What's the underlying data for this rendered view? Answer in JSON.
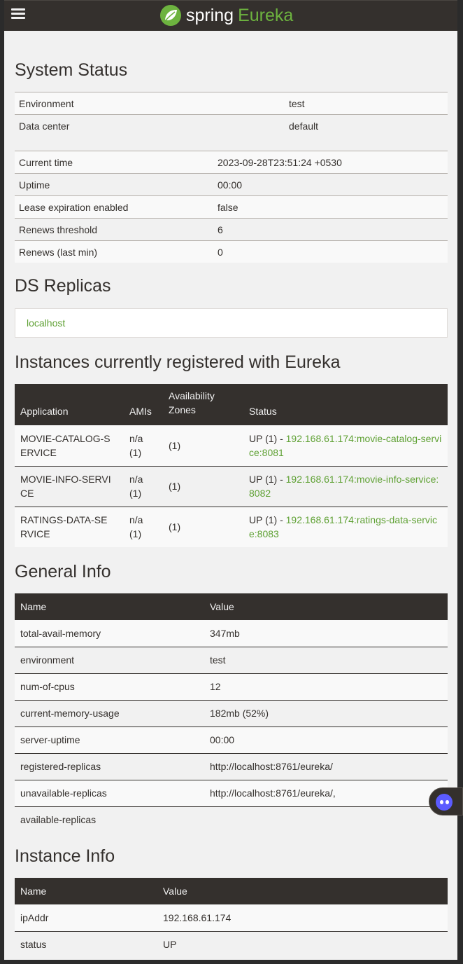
{
  "brand": {
    "spring": "spring",
    "eureka": "Eureka"
  },
  "system_status": {
    "title": "System Status",
    "env_rows": [
      {
        "label": "Environment",
        "value": "test"
      },
      {
        "label": "Data center",
        "value": "default"
      }
    ],
    "time_rows": [
      {
        "label": "Current time",
        "value": "2023-09-28T23:51:24 +0530"
      },
      {
        "label": "Uptime",
        "value": "00:00"
      },
      {
        "label": "Lease expiration enabled",
        "value": "false"
      },
      {
        "label": "Renews threshold",
        "value": "6"
      },
      {
        "label": "Renews (last min)",
        "value": "0"
      }
    ]
  },
  "ds_replicas": {
    "title": "DS Replicas",
    "item": "localhost"
  },
  "instances": {
    "title": "Instances currently registered with Eureka",
    "headers": [
      "Application",
      "AMIs",
      "Availability Zones",
      "Status"
    ],
    "rows": [
      {
        "app": "MOVIE-CATALOG-SERVICE",
        "amis": "n/a (1)",
        "zones": "(1)",
        "status_prefix": "UP (1) - ",
        "status_link": "192.168.61.174:movie-catalog-service:8081"
      },
      {
        "app": "MOVIE-INFO-SERVICE",
        "amis": "n/a (1)",
        "zones": "(1)",
        "status_prefix": "UP (1) - ",
        "status_link": "192.168.61.174:movie-info-service:8082"
      },
      {
        "app": "RATINGS-DATA-SERVICE",
        "amis": "n/a (1)",
        "zones": "(1)",
        "status_prefix": "UP (1) - ",
        "status_link": "192.168.61.174:ratings-data-service:8083"
      }
    ]
  },
  "general_info": {
    "title": "General Info",
    "headers": [
      "Name",
      "Value"
    ],
    "rows": [
      {
        "name": "total-avail-memory",
        "value": "347mb"
      },
      {
        "name": "environment",
        "value": "test"
      },
      {
        "name": "num-of-cpus",
        "value": "12"
      },
      {
        "name": "current-memory-usage",
        "value": "182mb (52%)"
      },
      {
        "name": "server-uptime",
        "value": "00:00"
      },
      {
        "name": "registered-replicas",
        "value": "http://localhost:8761/eureka/"
      },
      {
        "name": "unavailable-replicas",
        "value": "http://localhost:8761/eureka/,"
      },
      {
        "name": "available-replicas",
        "value": ""
      }
    ]
  },
  "instance_info": {
    "title": "Instance Info",
    "headers": [
      "Name",
      "Value"
    ],
    "rows": [
      {
        "name": "ipAddr",
        "value": "192.168.61.174"
      },
      {
        "name": "status",
        "value": "UP"
      }
    ]
  },
  "colors": {
    "nav": "#34302d",
    "accent": "#6db33f",
    "link": "#5fa134",
    "page": "#f1f1f1"
  },
  "icons": {
    "menu": "hamburger-menu-icon",
    "logo": "spring-leaf-icon",
    "chat": "chat-assistant-icon"
  }
}
